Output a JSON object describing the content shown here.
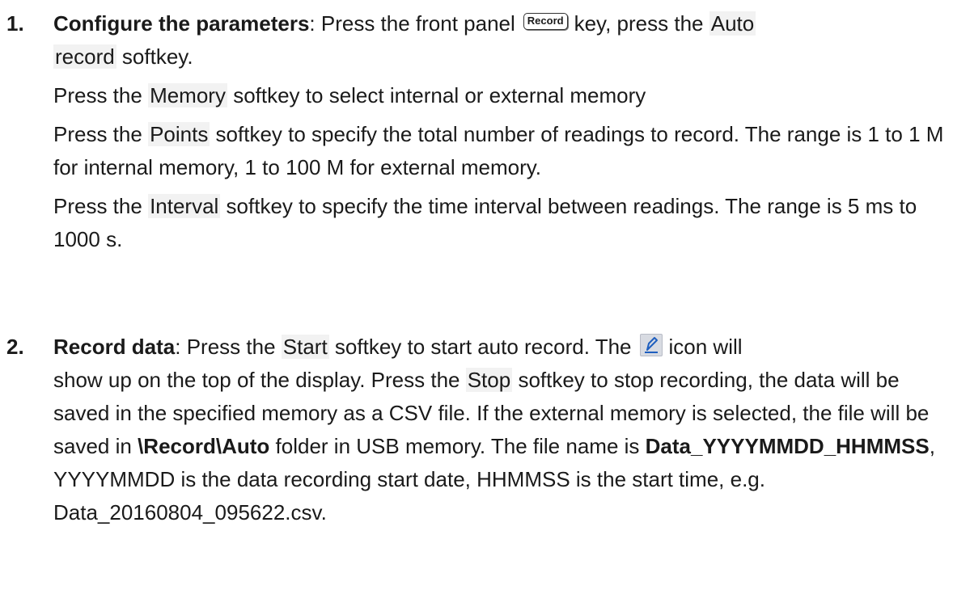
{
  "step1": {
    "number": "1.",
    "title": "Configure the parameters",
    "line1_a": ": Press the front panel",
    "record_key": "Record",
    "line1_b": "key, press the",
    "auto_record_a": "Auto",
    "auto_record_b": "record",
    "line1_c": " softkey.",
    "memory_softkey": "Memory",
    "memory_text": " softkey to select internal or external memory",
    "points_softkey": "Points",
    "points_text": " softkey to specify the total number of readings to record. The range is 1 to 1 M for internal memory, 1 to 100 M for external memory.",
    "interval_softkey": "Interval",
    "interval_text": " softkey to specify the time interval between readings. The range is 5 ms to 1000 s.",
    "press_the": "Press the "
  },
  "step2": {
    "number": "2.",
    "title": "Record data",
    "text_a": ": Press the ",
    "start_softkey": "Start",
    "text_b": " softkey to start auto record. The",
    "icon_name": "pen-icon",
    "text_c": "icon will",
    "text_d": "show up on the top of the display. Press the ",
    "stop_softkey": "Stop",
    "text_e": " softkey to stop recording, the data will be saved in the specified memory as a CSV file. If the external memory is selected, the file will be saved in ",
    "folder": "\\Record\\Auto",
    "text_f": " folder in USB memory. The file name is ",
    "file_pattern": "Data_YYYYMMDD_HHMMSS",
    "text_g": ", YYYYMMDD is the data recording start date, HHMMSS is the start time, e.g.",
    "example": "Data_20160804_095622.csv."
  }
}
